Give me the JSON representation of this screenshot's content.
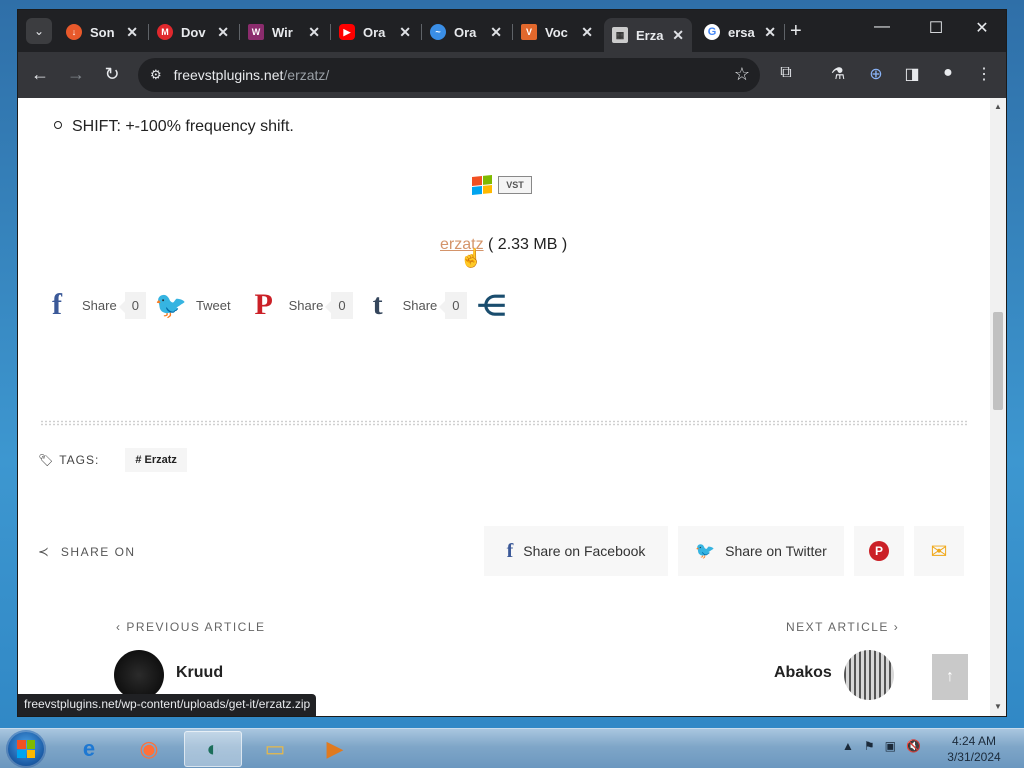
{
  "tabs": [
    {
      "title": "Son",
      "icon": "download-icon",
      "color": "#e8592b",
      "active": false
    },
    {
      "title": "Dov",
      "icon": "m-logo-icon",
      "color": "#e0282d",
      "active": false
    },
    {
      "title": "Wir",
      "icon": "winrar-icon",
      "color": "#8b2c6d",
      "active": false
    },
    {
      "title": "Ora",
      "icon": "youtube-icon",
      "color": "#ff0000",
      "active": false
    },
    {
      "title": "Ora",
      "icon": "edge-wave-icon",
      "color": "#3a8ee6",
      "active": false
    },
    {
      "title": "Voc",
      "icon": "vocal-app-icon",
      "color": "#e2682c",
      "active": false
    },
    {
      "title": "Erza",
      "icon": "plugin-thumb-icon",
      "color": "#cccccc",
      "active": true
    },
    {
      "title": "ersa",
      "icon": "google-icon",
      "color": "#4285f4",
      "active": false
    }
  ],
  "address_bar": {
    "host": "freevstplugins.net",
    "path": "/erzatz/"
  },
  "page": {
    "feature_item": "SHIFT: +-100% frequency shift.",
    "download": {
      "link_text": "erzatz",
      "size_text": "( 2.33 MB )"
    },
    "social_share": [
      {
        "name": "facebook",
        "icon": "facebook-icon",
        "label": "Share",
        "count": "0",
        "color": "#3b5998"
      },
      {
        "name": "twitter",
        "icon": "twitter-icon",
        "label": "Tweet",
        "count": null,
        "color": "#1da1f2"
      },
      {
        "name": "pinterest",
        "icon": "pinterest-icon",
        "label": "Share",
        "count": "0",
        "color": "#cb2027"
      },
      {
        "name": "tumblr",
        "icon": "tumblr-icon",
        "label": "Share",
        "count": "0",
        "color": "#35465c"
      },
      {
        "name": "more",
        "icon": "share-nodes-icon",
        "label": null,
        "count": null,
        "color": "#1a4d6e"
      }
    ],
    "tags_label": "TAGS:",
    "tag_chip": "# Erzatz",
    "share_on_label": "SHARE ON",
    "share_facebook": "Share on Facebook",
    "share_twitter": "Share on Twitter",
    "prev_article_label": "PREVIOUS ARTICLE",
    "prev_article_title": "Kruud",
    "next_article_label": "NEXT ARTICLE",
    "next_article_title": "Abakos",
    "hover_status_url": "freevstplugins.net/wp-content/uploads/get-it/erzatz.zip"
  },
  "taskbar": {
    "items": [
      "internet-explorer-icon",
      "firefox-icon",
      "media-player-icon",
      "file-explorer-icon",
      "video-player-icon"
    ],
    "active_item": "media-player-icon",
    "clock_time": "4:24 AM",
    "clock_date": "3/31/2024"
  },
  "colors": {
    "chrome_dark": "#202124",
    "chrome_toolbar": "#35363a",
    "download_link": "#d4946a",
    "facebook": "#3b5998",
    "twitter": "#1da1f2",
    "pinterest": "#cb2027",
    "email": "#f0a81a"
  }
}
